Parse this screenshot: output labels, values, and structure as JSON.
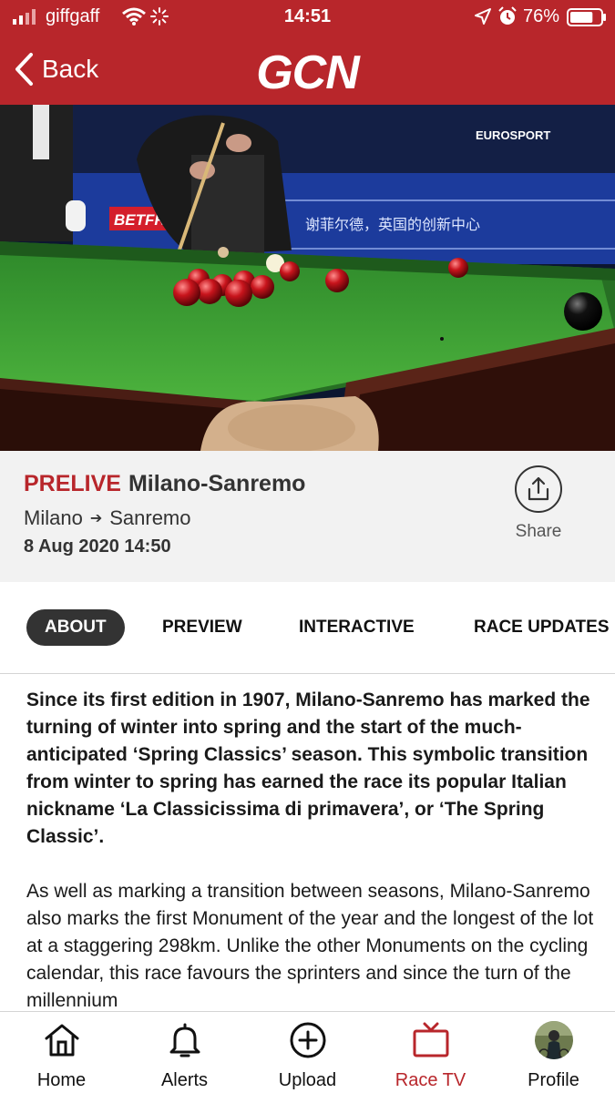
{
  "status_bar": {
    "carrier": "giffgaff",
    "time": "14:51",
    "battery": "76%",
    "battery_level": 0.76
  },
  "nav": {
    "back_label": "Back",
    "logo": "GCN"
  },
  "video": {
    "broadcaster": "EUROSPORT",
    "sponsor": "BETFR",
    "banner": "谢菲尔德，英国的创新中心"
  },
  "race": {
    "status": "PRELIVE",
    "name": "Milano-Sanremo",
    "start": "Milano",
    "finish": "Sanremo",
    "date": "8 Aug 2020 14:50",
    "share_label": "Share"
  },
  "tabs": [
    {
      "label": "ABOUT",
      "active": true
    },
    {
      "label": "PREVIEW",
      "active": false
    },
    {
      "label": "INTERACTIVE",
      "active": false
    },
    {
      "label": "RACE UPDATES",
      "active": false
    }
  ],
  "article": {
    "lead": "Since its first edition in 1907, Milano-Sanremo has marked the turning of winter into spring and the start of the much-anticipated ‘Spring Classics’ season. This symbolic transition from winter to spring has earned the race its popular Italian nickname ‘La Classicissima di primavera’, or ‘The Spring Classic’.",
    "body": "As well as marking a transition between seasons, Milano-Sanremo also marks the first Monument of the year and the longest of the lot at a staggering 298km. Unlike the other Monuments on the cycling calendar, this race favours the sprinters and since the turn of the millennium"
  },
  "bottom_nav": [
    {
      "label": "Home",
      "icon": "home-icon",
      "active": false
    },
    {
      "label": "Alerts",
      "icon": "bell-icon",
      "active": false
    },
    {
      "label": "Upload",
      "icon": "plus-circle-icon",
      "active": false
    },
    {
      "label": "Race TV",
      "icon": "tv-icon",
      "active": true
    },
    {
      "label": "Profile",
      "icon": "avatar",
      "active": false
    }
  ],
  "colors": {
    "brand_red": "#b8262b",
    "tab_active_bg": "#333333",
    "info_bg": "#f2f2f2"
  }
}
